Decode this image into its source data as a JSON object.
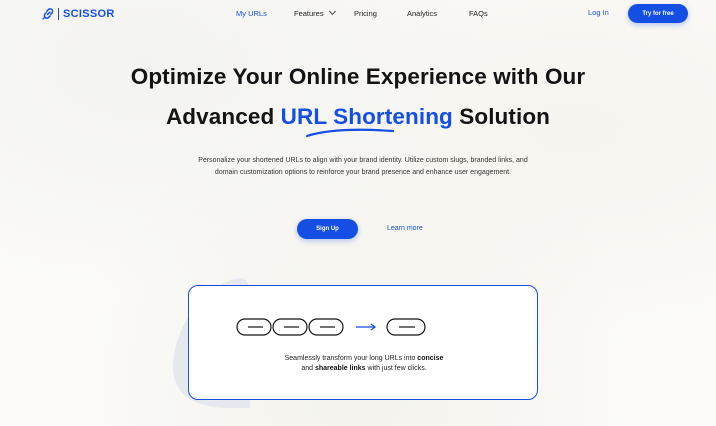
{
  "brand": {
    "name": "SCISSOR",
    "color": "#144ee3",
    "icon": "link-icon"
  },
  "nav": {
    "items": [
      {
        "label": "My URLs",
        "active": true
      },
      {
        "label": "Features",
        "has_dropdown": true
      },
      {
        "label": "Pricing"
      },
      {
        "label": "Analytics"
      },
      {
        "label": "FAQs"
      }
    ],
    "login_label": "Log In",
    "try_label": "Try for free"
  },
  "hero": {
    "title_line1": "Optimize Your Online Experience with Our",
    "title_line2_pre": "Advanced",
    "title_line2_highlight": "URL Shortening",
    "title_line2_post": "Solution",
    "subtitle": "Personalize your shortened URLs to align with your brand identity. Utilize custom slugs, branded links, and domain customization options to reinforce your brand presence and enhance user engagement.",
    "signup_label": "Sign Up",
    "learn_label": "Learn more"
  },
  "card": {
    "text_pre": "Seamlessly transform your long URLs into",
    "text_bold1": "concise",
    "text_mid": "and",
    "text_bold2": "shareable links",
    "text_post": "with just few clicks.",
    "icons": [
      "long-chain-icon",
      "arrow-right-icon",
      "short-chain-icon"
    ]
  }
}
